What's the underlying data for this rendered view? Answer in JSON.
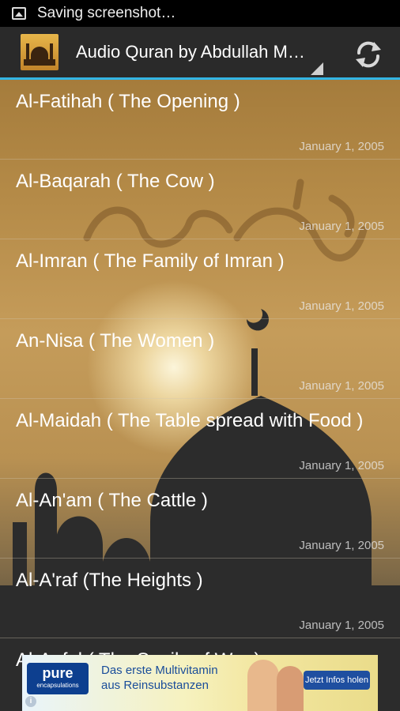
{
  "status_bar": {
    "notification_text": "Saving screenshot…",
    "icon": "image-icon"
  },
  "action_bar": {
    "title": "Audio Quran by Abdullah Matroud",
    "logo": "app-logo",
    "refresh_icon": "refresh-icon",
    "accent_color": "#33b5e5"
  },
  "surahs": [
    {
      "title": "Al-Fatihah ( The Opening )",
      "date": "January 1, 2005"
    },
    {
      "title": "Al-Baqarah ( The Cow )",
      "date": "January 1, 2005"
    },
    {
      "title": "Al-Imran ( The Family of Imran )",
      "date": "January 1, 2005"
    },
    {
      "title": "An-Nisa ( The Women )",
      "date": "January 1, 2005"
    },
    {
      "title": "Al-Maidah ( The Table spread with Food )",
      "date": "January 1, 2005"
    },
    {
      "title": "Al-An'am ( The Cattle )",
      "date": "January 1, 2005"
    },
    {
      "title": "Al-A'raf (The Heights )",
      "date": "January 1, 2005"
    },
    {
      "title": "Al-Anfal ( The Spoils of War )",
      "date": ""
    }
  ],
  "ad": {
    "brand_name": "pure",
    "brand_sub": "encapsulations",
    "text_line1": "Das erste Multivitamin",
    "text_line2": "aus Reinsubstanzen",
    "cta": "Jetzt Infos holen",
    "info": "i"
  }
}
